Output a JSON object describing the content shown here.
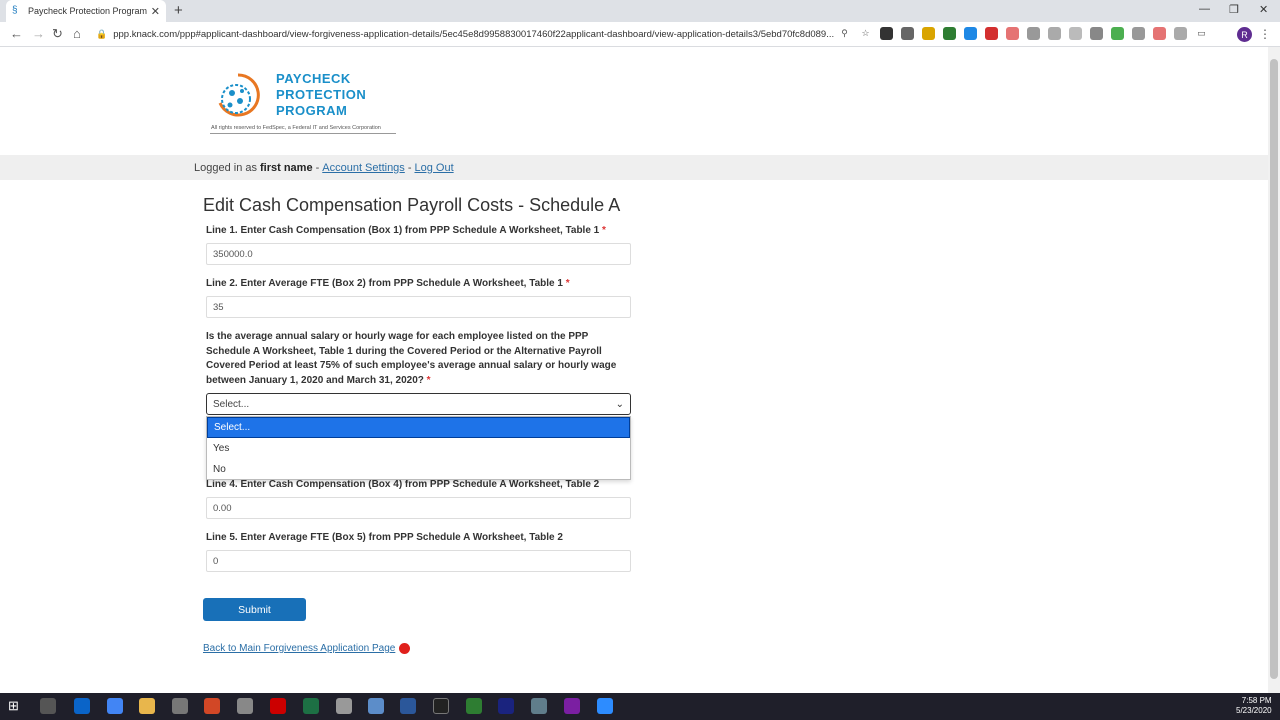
{
  "browser": {
    "tab_title": "Paycheck Protection Program Se",
    "url": "ppp.knack.com/ppp#applicant-dashboard/view-forgiveness-application-details/5ec45e8d9958830017460f22applicant-dashboard/view-application-details3/5ebd70fc8d089..."
  },
  "logo": {
    "line1": "PAYCHECK",
    "line2": "PROTECTION",
    "line3": "PROGRAM",
    "rights": "All rights reserved to FedSpec, a Federal IT and Services Corporation"
  },
  "userbar": {
    "prefix": "Logged in as",
    "name": "first name",
    "sep1": "-",
    "account_settings": "Account Settings",
    "sep2": "-",
    "logout": "Log Out"
  },
  "form": {
    "title": "Edit Cash Compensation Payroll Costs - Schedule A",
    "line1_label": "Line 1. Enter Cash Compensation (Box 1) from PPP Schedule A Worksheet, Table 1",
    "line1_value": "350000.0",
    "line2_label": "Line 2. Enter Average FTE (Box 2) from PPP Schedule A Worksheet, Table 1",
    "line2_value": "35",
    "question": "Is the average annual salary or hourly wage for each employee listed on the PPP Schedule A Worksheet, Table 1 during the Covered Period or the Alternative Payroll Covered Period at least 75% of such employee's average annual salary or hourly wage between January 1, 2020 and March 31, 2020?",
    "required_mark": "*",
    "select_value": "Select...",
    "options": [
      "Select...",
      "Yes",
      "No"
    ],
    "line4_label": "Line 4. Enter Cash Compensation (Box 4) from PPP Schedule A Worksheet, Table 2",
    "line4_value": "0.00",
    "line5_label": "Line 5. Enter Average FTE (Box 5) from PPP Schedule A Worksheet, Table 2",
    "line5_value": "0",
    "submit": "Submit",
    "back_link": "Back to Main Forgiveness Application Page"
  },
  "taskbar": {
    "time": "7:58 PM",
    "date": "5/23/2020"
  },
  "colors": {
    "brand": "#1a8fc9",
    "submit": "#1870b8",
    "selected_option": "#1e73e8",
    "link": "#2a6ea6"
  }
}
